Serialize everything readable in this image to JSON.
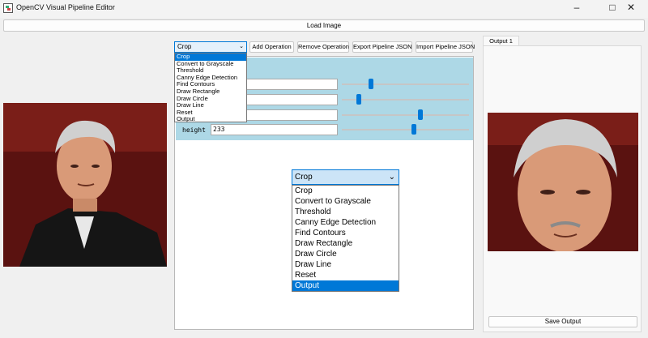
{
  "window": {
    "title": "OpenCV Visual Pipeline Editor",
    "minimize_icon": "minimize-icon",
    "maximize_icon": "maximize-icon",
    "close_icon": "close-icon"
  },
  "toolbar": {
    "load_label": "Load Image",
    "operation_selected": "Crop",
    "add_label": "Add Operation",
    "remove_label": "Remove Operation",
    "export_label": "Export Pipeline JSON",
    "import_label": "Import Pipeline JSON"
  },
  "operations": [
    "Crop",
    "Convert to Grayscale",
    "Threshold",
    "Canny Edge Detection",
    "Find Contours",
    "Draw Rectangle",
    "Draw Circle",
    "Draw Line",
    "Reset",
    "Output"
  ],
  "params": {
    "height_label": "height",
    "height_value": "233",
    "sliders": [
      0.22,
      0.12,
      0.62,
      0.57
    ]
  },
  "pipeline_step": {
    "selected": "Crop",
    "highlighted_option": "Output"
  },
  "output": {
    "tab_label": "Output 1",
    "save_label": "Save Output"
  },
  "colors": {
    "accent": "#0078d7",
    "param_bg": "#add8e6",
    "selection": "#0078d7"
  }
}
